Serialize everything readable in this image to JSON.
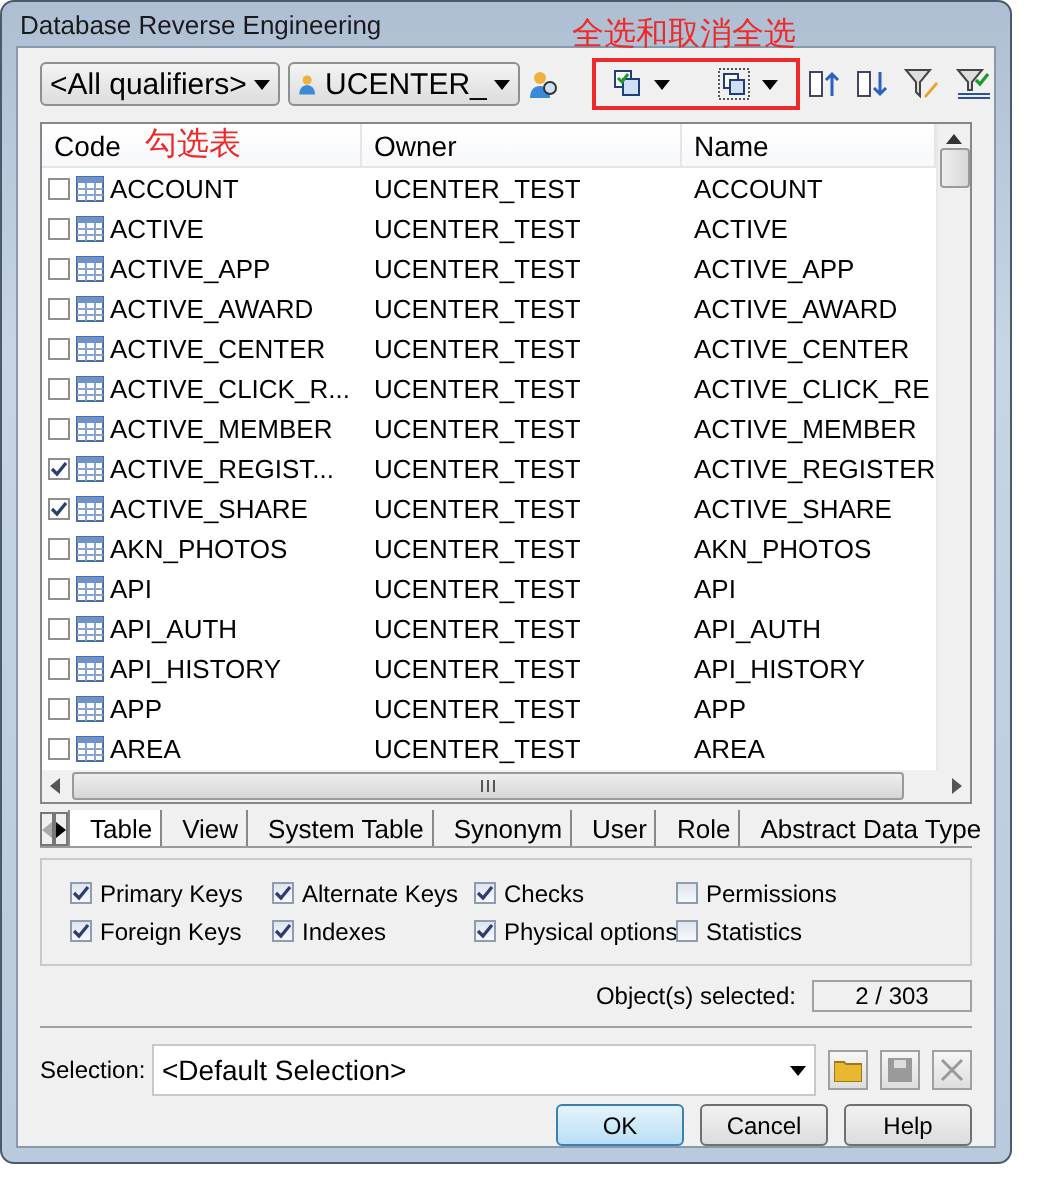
{
  "window": {
    "title": "Database Reverse Engineering"
  },
  "annotations": [
    {
      "text": "全选和取消全选",
      "kind": "boxed"
    },
    {
      "text": "勾选表",
      "kind": "plain"
    }
  ],
  "toolbar": {
    "qualifier": "<All qualifiers>",
    "owner": "UCENTER_"
  },
  "table": {
    "columns": [
      "Code",
      "Owner",
      "Name"
    ],
    "rows": [
      {
        "code": "ACCOUNT",
        "owner": "UCENTER_TEST",
        "name": "ACCOUNT",
        "checked": false
      },
      {
        "code": "ACTIVE",
        "owner": "UCENTER_TEST",
        "name": "ACTIVE",
        "checked": false
      },
      {
        "code": "ACTIVE_APP",
        "owner": "UCENTER_TEST",
        "name": "ACTIVE_APP",
        "checked": false
      },
      {
        "code": "ACTIVE_AWARD",
        "owner": "UCENTER_TEST",
        "name": "ACTIVE_AWARD",
        "checked": false
      },
      {
        "code": "ACTIVE_CENTER",
        "owner": "UCENTER_TEST",
        "name": "ACTIVE_CENTER",
        "checked": false
      },
      {
        "code": "ACTIVE_CLICK_R...",
        "owner": "UCENTER_TEST",
        "name": "ACTIVE_CLICK_RE",
        "checked": false
      },
      {
        "code": "ACTIVE_MEMBER",
        "owner": "UCENTER_TEST",
        "name": "ACTIVE_MEMBER",
        "checked": false
      },
      {
        "code": "ACTIVE_REGIST...",
        "owner": "UCENTER_TEST",
        "name": "ACTIVE_REGISTER",
        "checked": true
      },
      {
        "code": "ACTIVE_SHARE",
        "owner": "UCENTER_TEST",
        "name": "ACTIVE_SHARE",
        "checked": true
      },
      {
        "code": "AKN_PHOTOS",
        "owner": "UCENTER_TEST",
        "name": "AKN_PHOTOS",
        "checked": false
      },
      {
        "code": "API",
        "owner": "UCENTER_TEST",
        "name": "API",
        "checked": false
      },
      {
        "code": "API_AUTH",
        "owner": "UCENTER_TEST",
        "name": "API_AUTH",
        "checked": false
      },
      {
        "code": "API_HISTORY",
        "owner": "UCENTER_TEST",
        "name": "API_HISTORY",
        "checked": false
      },
      {
        "code": "APP",
        "owner": "UCENTER_TEST",
        "name": "APP",
        "checked": false
      },
      {
        "code": "AREA",
        "owner": "UCENTER_TEST",
        "name": "AREA",
        "checked": false
      }
    ]
  },
  "tabs": [
    {
      "label": "Table",
      "selected": true
    },
    {
      "label": "View",
      "selected": false
    },
    {
      "label": "System Table",
      "selected": false
    },
    {
      "label": "Synonym",
      "selected": false
    },
    {
      "label": "User",
      "selected": false
    },
    {
      "label": "Role",
      "selected": false
    },
    {
      "label": "Abstract Data Type",
      "selected": false
    }
  ],
  "options": [
    {
      "label": "Primary Keys",
      "checked": true
    },
    {
      "label": "Alternate Keys",
      "checked": true
    },
    {
      "label": "Checks",
      "checked": true
    },
    {
      "label": "Permissions",
      "checked": false
    },
    {
      "label": "Foreign Keys",
      "checked": true
    },
    {
      "label": "Indexes",
      "checked": true
    },
    {
      "label": "Physical options",
      "checked": true
    },
    {
      "label": "Statistics",
      "checked": false
    }
  ],
  "selected_count": {
    "label": "Object(s) selected:",
    "value": "2 / 303"
  },
  "selection": {
    "label": "Selection:",
    "value": "<Default Selection>"
  },
  "buttons": [
    {
      "label": "OK",
      "kind": "default"
    },
    {
      "label": "Cancel",
      "kind": "normal"
    },
    {
      "label": "Help",
      "kind": "normal"
    }
  ]
}
